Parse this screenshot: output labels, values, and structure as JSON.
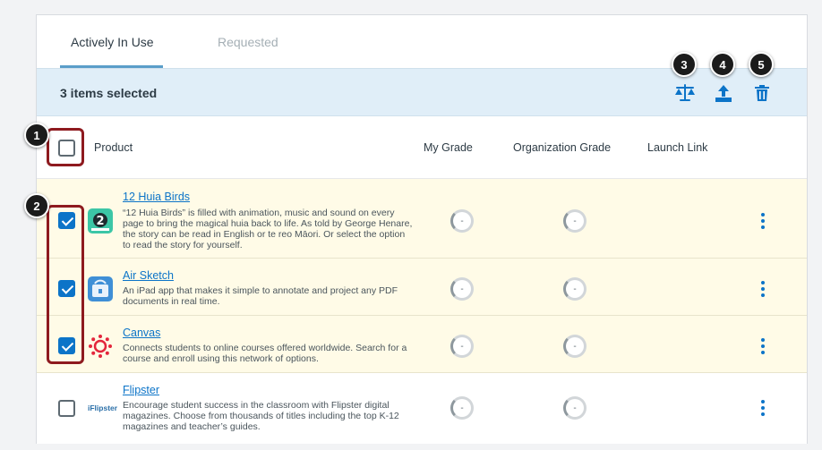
{
  "tabs": [
    {
      "label": "Actively In Use",
      "active": true
    },
    {
      "label": "Requested",
      "active": false
    }
  ],
  "selection_bar": {
    "text": "3 items selected",
    "icons": [
      "scales-icon",
      "upload-icon",
      "trash-icon"
    ]
  },
  "table_header": {
    "product": "Product",
    "my_grade": "My Grade",
    "org_grade": "Organization Grade",
    "launch_link": "Launch Link"
  },
  "rows": [
    {
      "name": "12 Huia Birds",
      "description": "“12 Huia Birds” is filled with animation, music and sound on every page to bring the magical huia back to life. As told by George Henare, the story can be read in English or te reo Māori. Or select the option to read the story for yourself.",
      "selected": true,
      "my_grade": "-",
      "org_grade": "-"
    },
    {
      "name": "Air Sketch",
      "description": "An iPad app that makes it simple to annotate and project any PDF documents in real time.",
      "selected": true,
      "my_grade": "-",
      "org_grade": "-"
    },
    {
      "name": "Canvas",
      "description": "Connects students to online courses offered worldwide. Search for a course and enroll using this network of options.",
      "selected": true,
      "my_grade": "-",
      "org_grade": "-"
    },
    {
      "name": "Flipster",
      "description": "Encourage student success in the classroom with Flipster digital magazines. Choose from thousands of titles including the top K-12 magazines and teacher’s guides.",
      "selected": false,
      "my_grade": "-",
      "org_grade": "-"
    }
  ],
  "flipster_logo_text": "iFlipster",
  "callouts": [
    "1",
    "2",
    "3",
    "4",
    "5"
  ],
  "colors": {
    "accent": "#0c74c8",
    "selection_bg": "#e0eef8",
    "selected_row_bg": "#fffbe7",
    "callout_box": "#8e1a1f"
  }
}
